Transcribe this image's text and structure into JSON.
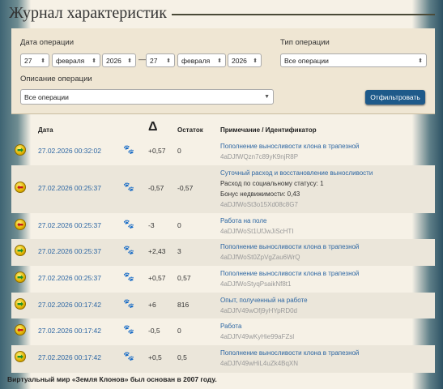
{
  "page_title": "Журнал характеристик",
  "filter": {
    "date_label": "Дата операции",
    "type_label": "Тип операции",
    "desc_label": "Описание операции",
    "from_day": "27",
    "from_month": "февраля",
    "from_year": "2026",
    "dash": "—",
    "to_day": "27",
    "to_month": "февраля",
    "to_year": "2026",
    "type_value": "Все операции",
    "desc_value": "Все операции",
    "button": "Отфильтровать"
  },
  "table": {
    "col_date": "Дата",
    "col_delta": "Δ",
    "col_balance": "Остаток",
    "col_note": "Примечание / Идентификатор",
    "rows": [
      {
        "dir": "in",
        "date": "27.02.2026 00:32:02",
        "delta": "+0,57",
        "balance": "0",
        "note": "Пополнение выносливости клона в трапезной",
        "extra1": "",
        "extra2": "",
        "id": "4aDJfWQzn7c89yK9njR8P"
      },
      {
        "dir": "out",
        "date": "27.02.2026 00:25:37",
        "delta": "-0,57",
        "balance": "-0,57",
        "note": "Суточный расход и восстановление выносливости",
        "extra1": "Расход по социальному статусу: 1",
        "extra2": "Бонус недвижимости: 0,43",
        "id": "4aDJfWoSt3o15Xd08c8G7"
      },
      {
        "dir": "out",
        "date": "27.02.2026 00:25:37",
        "delta": "-3",
        "balance": "0",
        "note": "Работа на поле",
        "extra1": "",
        "extra2": "",
        "id": "4aDJfWoSt1UfJwJiScHTI"
      },
      {
        "dir": "in",
        "date": "27.02.2026 00:25:37",
        "delta": "+2,43",
        "balance": "3",
        "note": "Пополнение выносливости клона в трапезной",
        "extra1": "",
        "extra2": "",
        "id": "4aDJfWoSt0ZpVgZau6WrQ"
      },
      {
        "dir": "in",
        "date": "27.02.2026 00:25:37",
        "delta": "+0,57",
        "balance": "0,57",
        "note": "Пополнение выносливости клона в трапезной",
        "extra1": "",
        "extra2": "",
        "id": "4aDJfWoStyqPsaikNf8t1"
      },
      {
        "dir": "in",
        "date": "27.02.2026 00:17:42",
        "delta": "+6",
        "balance": "816",
        "note": "Опыт, полученный на работе",
        "extra1": "",
        "extra2": "",
        "id": "4aDJfV49wOfj9yHYpRD0d"
      },
      {
        "dir": "out",
        "date": "27.02.2026 00:17:42",
        "delta": "-0,5",
        "balance": "0",
        "note": "Работа",
        "extra1": "",
        "extra2": "",
        "id": "4aDJfV49wKyHie99aFZsl"
      },
      {
        "dir": "in",
        "date": "27.02.2026 00:17:42",
        "delta": "+0,5",
        "balance": "0,5",
        "note": "Пополнение выносливости клона в трапезной",
        "extra1": "",
        "extra2": "",
        "id": "4aDJfV49wHiL4uZk4BqXN"
      }
    ]
  },
  "footer": "Виртуальный мир «Земля Клонов» был основан в 2007 году."
}
